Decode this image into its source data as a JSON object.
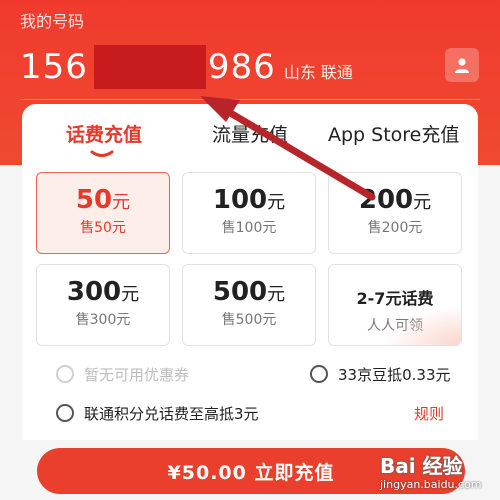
{
  "header": {
    "label": "我的号码",
    "phone_prefix": "156",
    "phone_suffix": "986",
    "carrier": "山东 联通"
  },
  "tabs": [
    {
      "label": "话费充值",
      "active": true
    },
    {
      "label": "流量充值",
      "active": false
    },
    {
      "label": "App Store充值",
      "active": false
    }
  ],
  "options": [
    {
      "amount": "50",
      "unit": "元",
      "sale": "售50元",
      "selected": true
    },
    {
      "amount": "100",
      "unit": "元",
      "sale": "售100元",
      "selected": false
    },
    {
      "amount": "200",
      "unit": "元",
      "sale": "售200元",
      "selected": false
    },
    {
      "amount": "300",
      "unit": "元",
      "sale": "售300元",
      "selected": false
    },
    {
      "amount": "500",
      "unit": "元",
      "sale": "售500元",
      "selected": false
    }
  ],
  "promo": {
    "title": "2-7元话费",
    "subtitle": "人人可领"
  },
  "discounts": {
    "coupon": "暂无可用优惠券",
    "jd_beans": "33京豆抵0.33元",
    "points": "联通积分兑话费至高抵3元",
    "rules_link": "规则"
  },
  "pay_button": "¥50.00  立即充值",
  "watermark": {
    "brand": "Bai 经验",
    "url": "jingyan.baidu.com"
  },
  "colors": {
    "accent": "#e53a2b",
    "header": "#f03a2e",
    "annotation_arrow": "#b7252a"
  }
}
